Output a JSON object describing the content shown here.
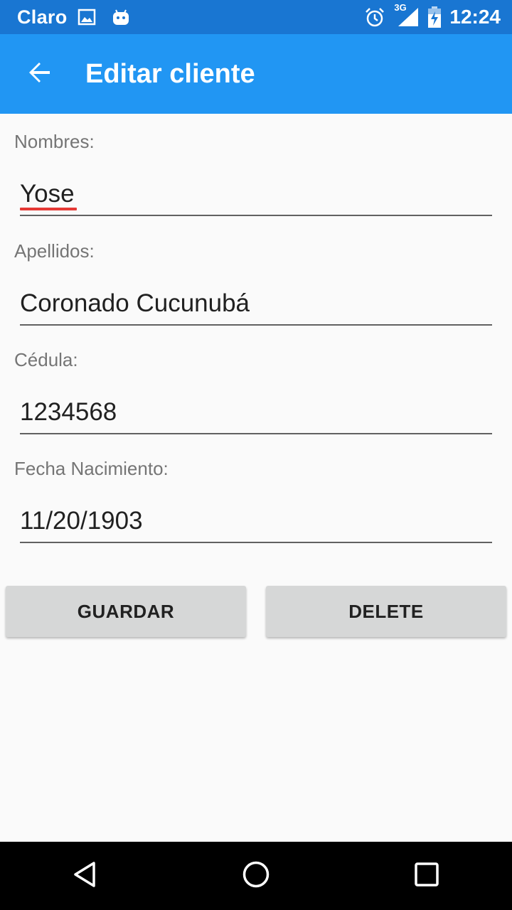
{
  "status_bar": {
    "carrier": "Claro",
    "network": "3G",
    "time": "12:24",
    "icons": [
      "image-icon",
      "android-icon",
      "alarm-icon",
      "signal-icon",
      "battery-charging-icon"
    ]
  },
  "app_bar": {
    "title": "Editar cliente",
    "back_icon": "arrow-back-icon",
    "color": "#2196f3"
  },
  "form": {
    "nombres": {
      "label": "Nombres:",
      "value": "Yose"
    },
    "apellidos": {
      "label": "Apellidos:",
      "value": "Coronado Cucunubá"
    },
    "cedula": {
      "label": "Cédula:",
      "value": "1234568"
    },
    "fecha": {
      "label": "Fecha Nacimiento:",
      "value": "11/20/1903"
    }
  },
  "buttons": {
    "save_label": "GUARDAR",
    "delete_label": "DELETE"
  },
  "nav_bar": {
    "icons": [
      "back-triangle-icon",
      "home-circle-icon",
      "recents-square-icon"
    ]
  }
}
